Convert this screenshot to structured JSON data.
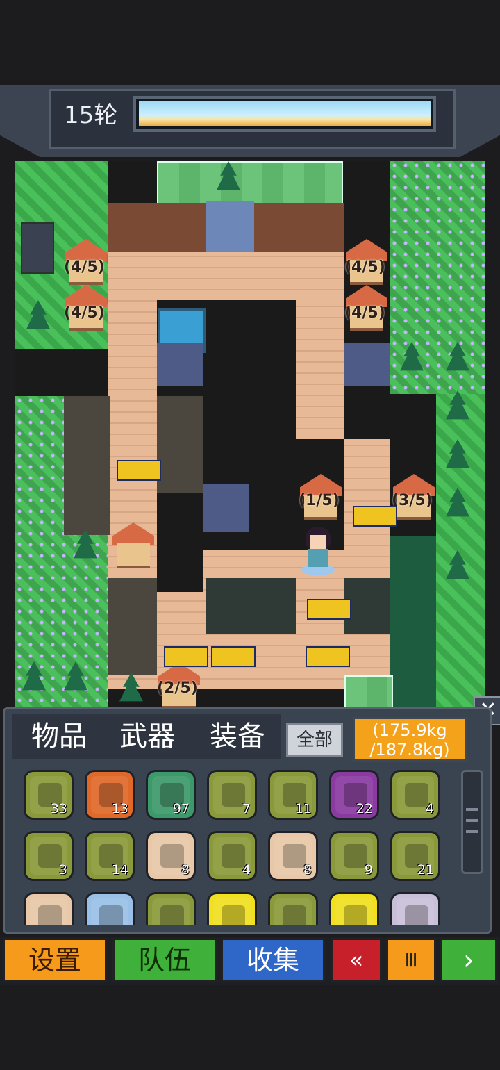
{
  "hud": {
    "round_label": "15轮",
    "round_progress": 1.0
  },
  "map": {
    "occupancy": [
      "(4/5)",
      "(4/5)",
      "(4/5)",
      "(4/5)",
      "(1/5)",
      "(3/5)",
      "(2/5)"
    ]
  },
  "inventory": {
    "tabs": [
      "物品",
      "武器",
      "装备"
    ],
    "filter_label": "全部",
    "weight_current": "(175.9kg",
    "weight_max": "/187.8kg)",
    "close_icon": "close-icon",
    "slots": [
      {
        "icon": "supplies-icon",
        "count": "33",
        "color": "#8a9a3a"
      },
      {
        "icon": "rope-icon",
        "count": "13",
        "color": "#e0692a"
      },
      {
        "icon": "wood-log-icon",
        "count": "97",
        "color": "#3c9a6a"
      },
      {
        "icon": "meat-can-icon",
        "count": "7",
        "color": "#8a9a3a"
      },
      {
        "icon": "bottle-icon",
        "count": "11",
        "color": "#8a9a3a"
      },
      {
        "icon": "shirt-icon",
        "count": "22",
        "color": "#8a3aa0"
      },
      {
        "icon": "egg-icon",
        "count": "4",
        "color": "#8a9a3a"
      },
      {
        "icon": "apple-icon",
        "count": "3",
        "color": "#8a9a3a"
      },
      {
        "icon": "steak-icon",
        "count": "14",
        "color": "#8a9a3a"
      },
      {
        "icon": "wire-icon",
        "count": "8",
        "color": "#e8c8a8"
      },
      {
        "icon": "chair-icon",
        "count": "4",
        "color": "#8a9a3a"
      },
      {
        "icon": "fish-icon",
        "count": "8",
        "color": "#e8c8a8"
      },
      {
        "icon": "cloth-icon",
        "count": "9",
        "color": "#8a9a3a"
      },
      {
        "icon": "boots-icon",
        "count": "21",
        "color": "#8a9a3a"
      },
      {
        "icon": "medkit-icon",
        "count": "",
        "color": "#e8c8a8"
      },
      {
        "icon": "circuit-icon",
        "count": "",
        "color": "#9ac0e8"
      },
      {
        "icon": "chili-icon",
        "count": "",
        "color": "#8a9a3a"
      },
      {
        "icon": "oil-bottle-icon",
        "count": "",
        "color": "#f0e020"
      },
      {
        "icon": "chocolate-icon",
        "count": "",
        "color": "#8a9a3a"
      },
      {
        "icon": "potion-icon",
        "count": "",
        "color": "#f0e020"
      },
      {
        "icon": "flashlight-icon",
        "count": "",
        "color": "#c8c0d8"
      }
    ]
  },
  "bottom_bar": {
    "settings": "设置",
    "team": "队伍",
    "collect": "收集",
    "rewind": "«",
    "pause": "Ⅲ",
    "next": "›",
    "colors": {
      "settings": "#f59a1b",
      "team": "#3fb13a",
      "collect": "#2f67c9",
      "rewind": "#c8202a",
      "pause": "#f59a1b",
      "next": "#3fb13a"
    }
  }
}
